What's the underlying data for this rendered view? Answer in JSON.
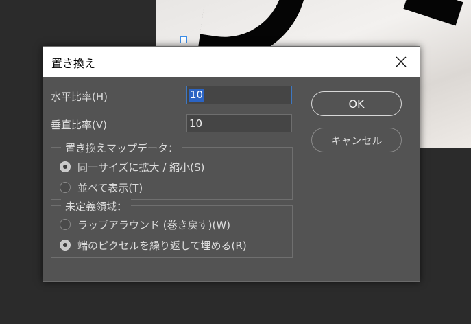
{
  "dialog": {
    "title": "置き換え",
    "close_icon": "close-icon"
  },
  "fields": {
    "horizontal_label": "水平比率(H)",
    "horizontal_value": "10",
    "vertical_label": "垂直比率(V)",
    "vertical_value": "10"
  },
  "buttons": {
    "ok_label": "OK",
    "cancel_label": "キャンセル"
  },
  "displacement_map": {
    "legend": "置き換えマップデータ：",
    "options": [
      {
        "label": "同一サイズに拡大 / 縮小(S)",
        "checked": true
      },
      {
        "label": "並べて表示(T)",
        "checked": false
      }
    ]
  },
  "undefined_areas": {
    "legend": "未定義領域：",
    "options": [
      {
        "label": "ラップアラウンド (巻き戻す)(W)",
        "checked": false
      },
      {
        "label": "端のピクセルを繰り返して埋める(R)",
        "checked": true
      }
    ]
  },
  "colors": {
    "dialog_bg": "#535353",
    "focus_accent": "#3e78c2",
    "selection_highlight": "#2b64c4",
    "app_bg": "#2b2b2b"
  }
}
